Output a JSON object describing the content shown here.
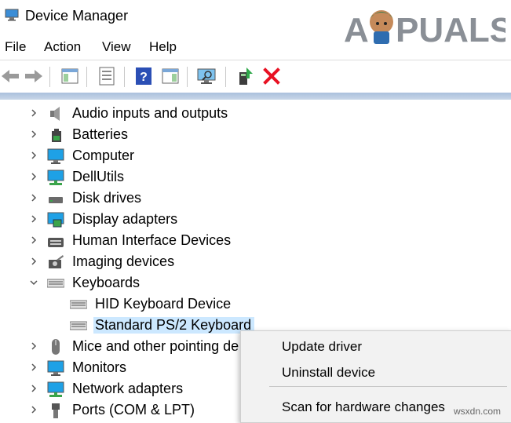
{
  "window": {
    "title": "Device Manager"
  },
  "watermark": {
    "brand": "APPUALS",
    "site": "wsxdn.com"
  },
  "menubar": [
    {
      "label": "File"
    },
    {
      "label": "Action"
    },
    {
      "label": "View"
    },
    {
      "label": "Help"
    }
  ],
  "toolbar": [
    {
      "icon": "back-arrow-icon"
    },
    {
      "icon": "forward-arrow-icon"
    },
    {
      "icon": "show-hide-console-tree-icon"
    },
    {
      "icon": "properties-icon"
    },
    {
      "icon": "help-icon"
    },
    {
      "icon": "show-action-pane-icon"
    },
    {
      "icon": "scan-hardware-changes-icon"
    },
    {
      "icon": "update-driver-icon"
    },
    {
      "icon": "uninstall-device-icon"
    }
  ],
  "tree": [
    {
      "label": "Audio inputs and outputs",
      "icon": "speaker-icon",
      "expanded": false,
      "level": 0
    },
    {
      "label": "Batteries",
      "icon": "battery-icon",
      "expanded": false,
      "level": 0
    },
    {
      "label": "Computer",
      "icon": "computer-icon",
      "expanded": false,
      "level": 0
    },
    {
      "label": "DellUtils",
      "icon": "network-monitor-icon",
      "expanded": false,
      "level": 0
    },
    {
      "label": "Disk drives",
      "icon": "disk-drive-icon",
      "expanded": false,
      "level": 0
    },
    {
      "label": "Display adapters",
      "icon": "display-adapter-icon",
      "expanded": false,
      "level": 0
    },
    {
      "label": "Human Interface Devices",
      "icon": "hid-icon",
      "expanded": false,
      "level": 0
    },
    {
      "label": "Imaging devices",
      "icon": "camera-icon",
      "expanded": false,
      "level": 0
    },
    {
      "label": "Keyboards",
      "icon": "keyboard-icon",
      "expanded": true,
      "level": 0
    },
    {
      "label": "HID Keyboard Device",
      "icon": "keyboard-icon",
      "level": 1
    },
    {
      "label": "Standard PS/2 Keyboard",
      "icon": "keyboard-icon",
      "level": 1,
      "selected": true
    },
    {
      "label": "Mice and other pointing de",
      "icon": "mouse-icon",
      "expanded": false,
      "level": 0
    },
    {
      "label": "Monitors",
      "icon": "monitor-icon",
      "expanded": false,
      "level": 0
    },
    {
      "label": "Network adapters",
      "icon": "network-adapter-icon",
      "expanded": false,
      "level": 0
    },
    {
      "label": "Ports (COM & LPT)",
      "icon": "port-icon",
      "expanded": false,
      "level": 0
    }
  ],
  "context_menu": [
    {
      "label": "Update driver"
    },
    {
      "label": "Uninstall device"
    },
    {
      "label": "Scan for hardware changes"
    }
  ],
  "colors": {
    "selection": "#cce8ff",
    "accent": "#1e7ad4",
    "delete": "#e81123"
  }
}
